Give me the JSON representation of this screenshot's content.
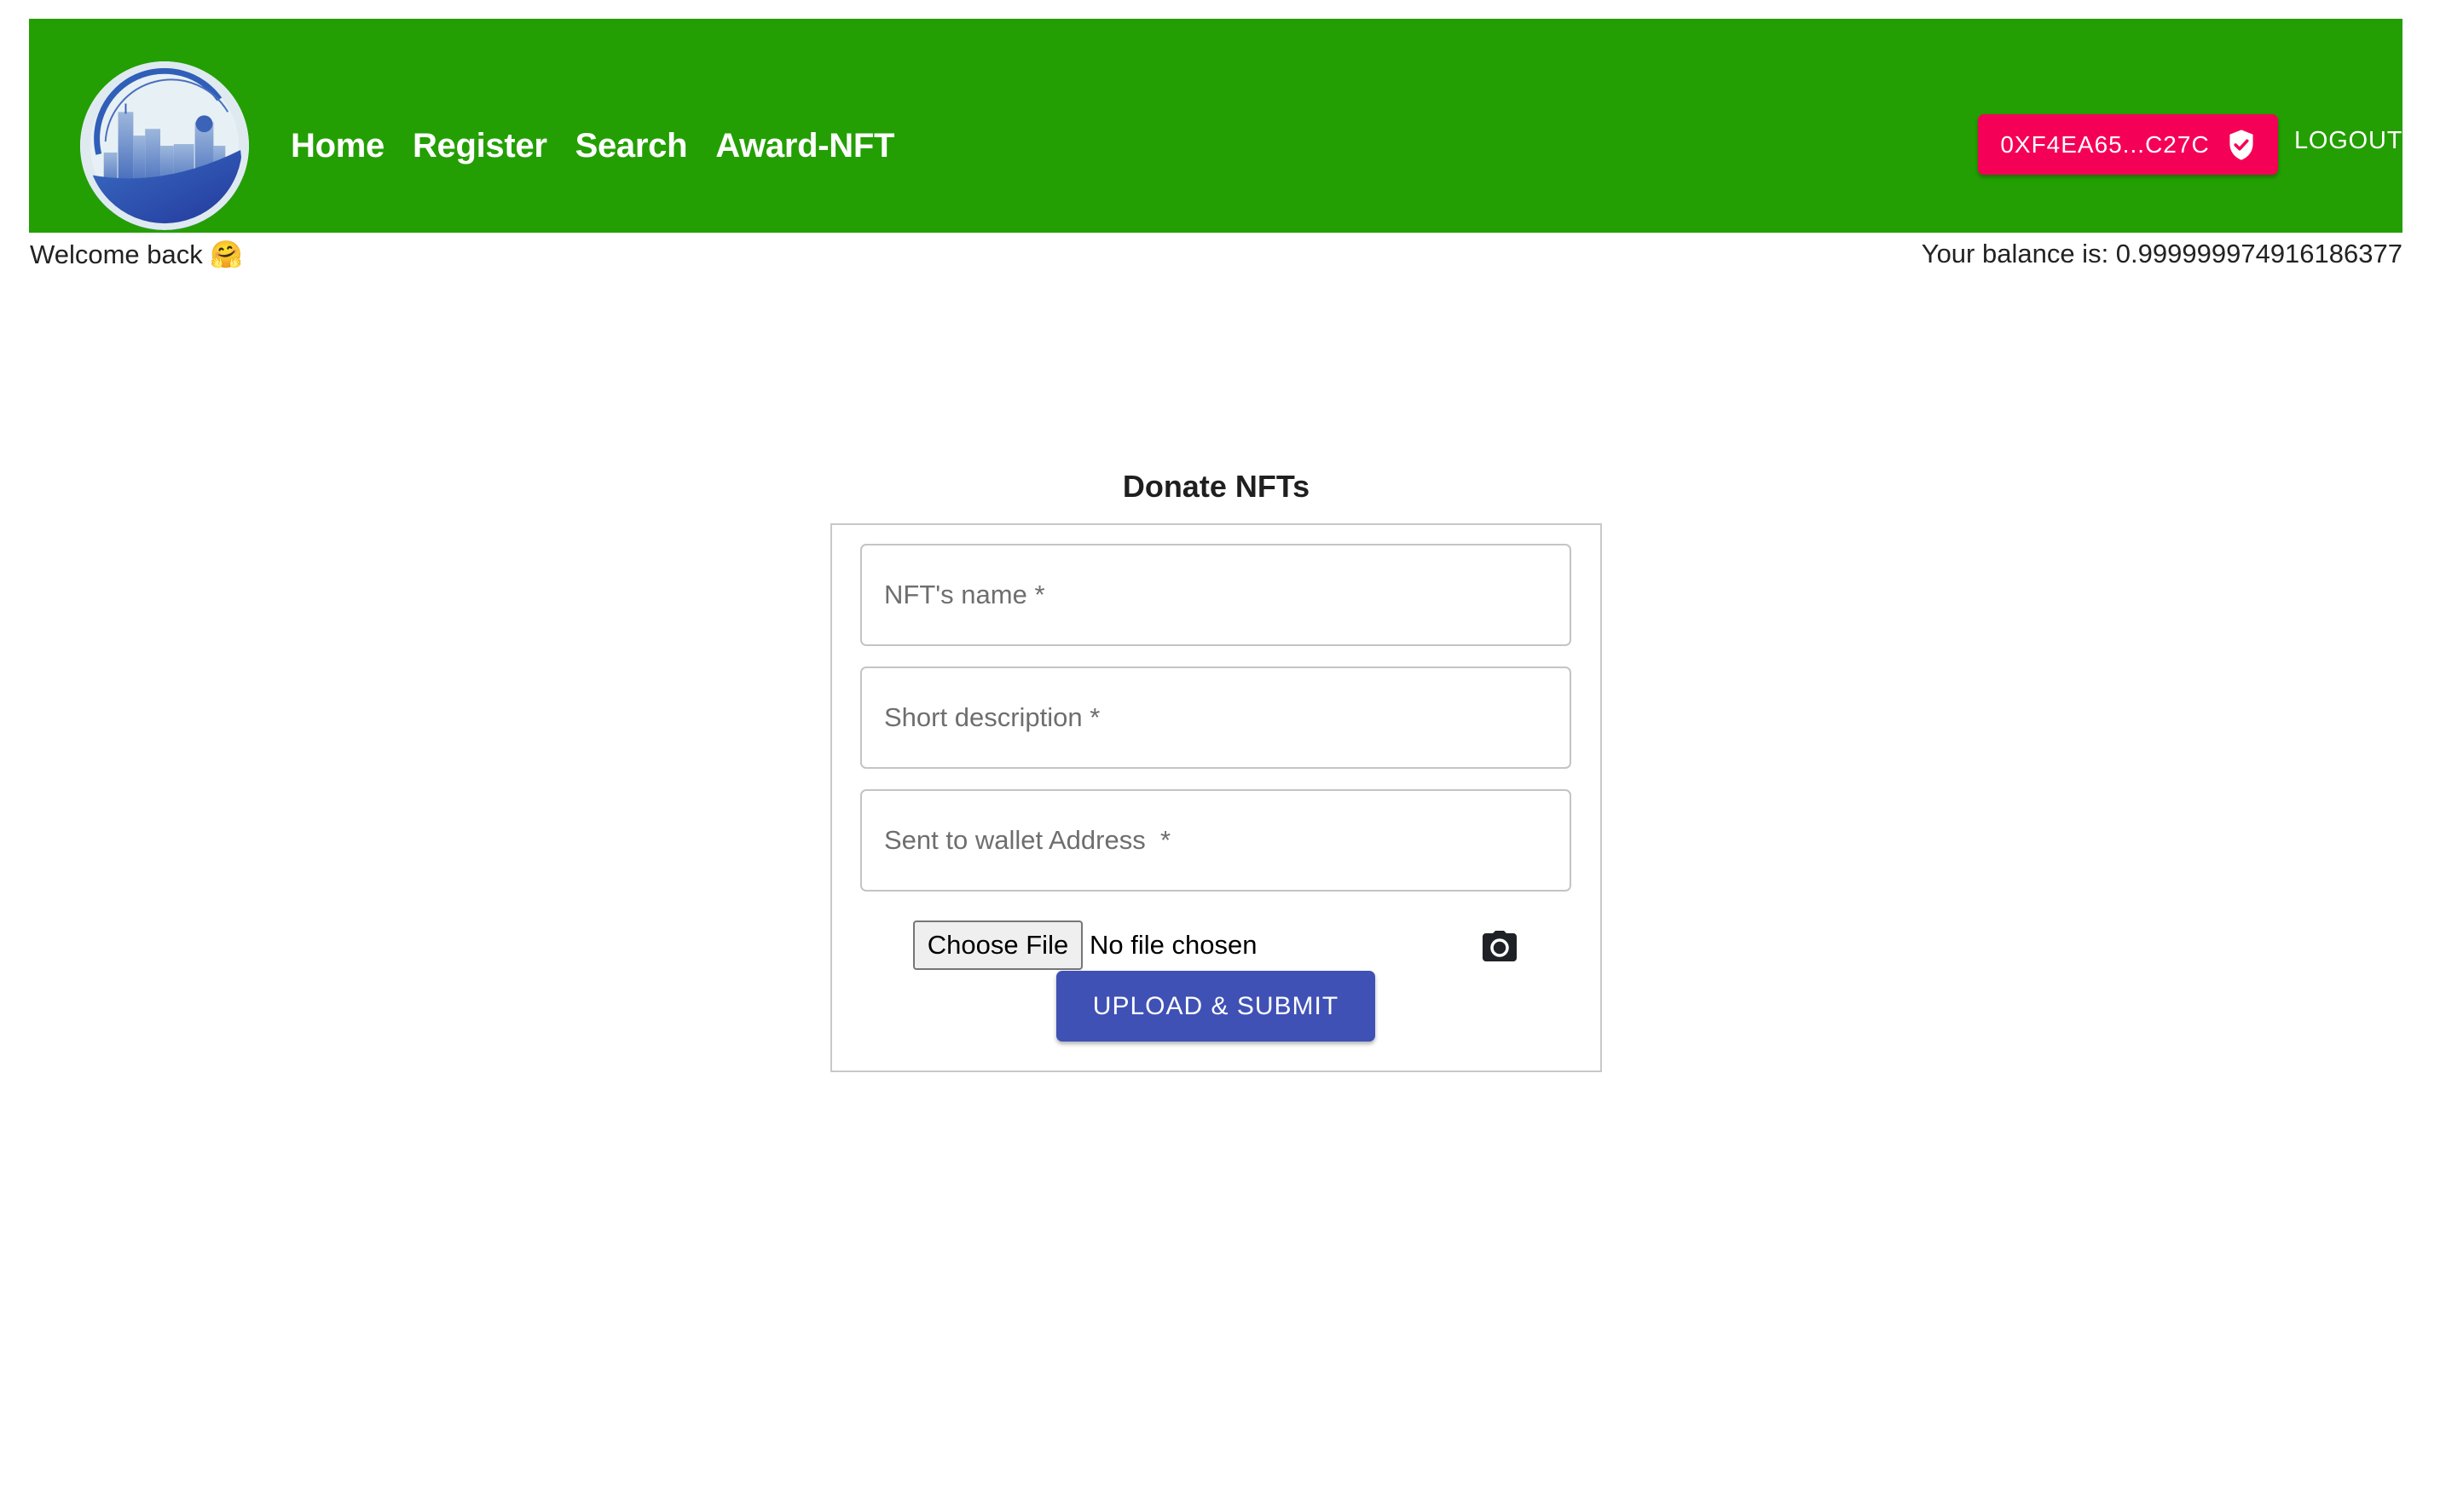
{
  "header": {
    "logo_alt": "city-skyline-logo",
    "nav": [
      {
        "label": "Home"
      },
      {
        "label": "Register"
      },
      {
        "label": "Search"
      },
      {
        "label": "Award-NFT"
      }
    ],
    "wallet_address": "0XF4EA65...C27C",
    "wallet_icon": "verified-shield-icon",
    "logout_label": "LOGOUT",
    "colors": {
      "header_bg": "#239f03",
      "wallet_bg": "#f50057"
    }
  },
  "status": {
    "welcome": "Welcome back 🤗",
    "balance": "Your balance is: 0.999999974916186377"
  },
  "form": {
    "title": "Donate NFTs",
    "fields": [
      {
        "placeholder": "NFT's name *",
        "value": ""
      },
      {
        "placeholder": "Short description *",
        "value": ""
      },
      {
        "placeholder": "Sent to wallet Address  *",
        "value": ""
      }
    ],
    "file_button_label": "Choose File",
    "file_status": "No file chosen",
    "camera_icon": "camera-icon",
    "submit_label": "UPLOAD & SUBMIT",
    "colors": {
      "submit_bg": "#3f51b5"
    }
  }
}
